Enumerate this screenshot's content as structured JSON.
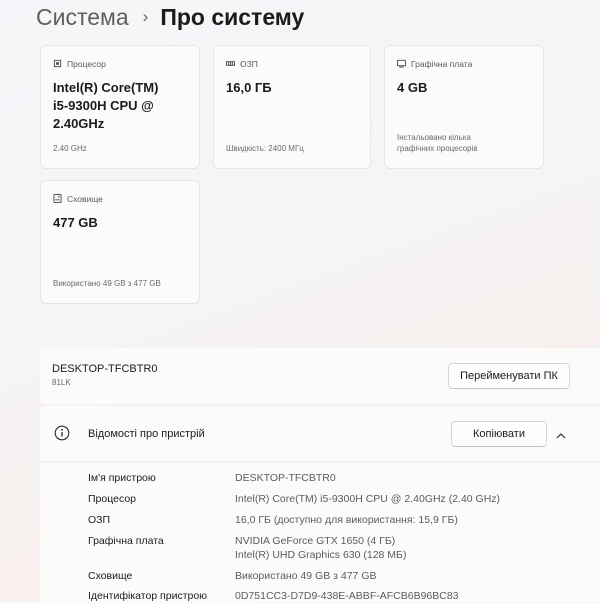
{
  "breadcrumb": {
    "parent": "Система",
    "separator": "›",
    "current": "Про систему"
  },
  "cards": {
    "processor": {
      "label": "Процесор",
      "value_lines": [
        "Intel(R) Core(TM)",
        "i5-9300H CPU @",
        "2.40GHz"
      ],
      "sub": "2.40 GHz",
      "icon": "cpu-icon"
    },
    "ram": {
      "label": "ОЗП",
      "value": "16,0 ГБ",
      "sub": "Швидкість: 2400 МГц",
      "icon": "memory-icon"
    },
    "gpu": {
      "label": "Графічна плата",
      "value": "4 GB",
      "sub_lines": [
        "Інстальовано кілька",
        "графічних процесорів"
      ],
      "icon": "display-icon"
    },
    "storage": {
      "label": "Сховище",
      "value": "477 GB",
      "sub": "Використано 49 GB з 477 GB",
      "icon": "storage-icon"
    }
  },
  "pc": {
    "name": "DESKTOP-TFCBTR0",
    "model": "81LK",
    "rename_label": "Перейменувати ПК"
  },
  "device_info": {
    "title": "Відомості про пристрій",
    "copy_label": "Копіювати",
    "rows": [
      {
        "label": "Ім'я пристрою",
        "values": [
          "DESKTOP-TFCBTR0"
        ]
      },
      {
        "label": "Процесор",
        "values": [
          "Intel(R) Core(TM) i5-9300H CPU @ 2.40GHz (2.40 GHz)"
        ]
      },
      {
        "label": "ОЗП",
        "values": [
          "16,0 ГБ (доступно для використання: 15,9 ГБ)"
        ]
      },
      {
        "label": "Графічна плата",
        "values": [
          "NVIDIA GeForce GTX 1650 (4 ГБ)",
          "Intel(R) UHD Graphics 630 (128 МБ)"
        ]
      },
      {
        "label": "Сховище",
        "values": [
          "Використано 49 GB з 477 GB"
        ]
      },
      {
        "label": "Ідентифікатор пристрою",
        "values": [
          "0D751CC3-D7D9-438E-ABBF-AFCB6B96BC83"
        ]
      }
    ]
  }
}
